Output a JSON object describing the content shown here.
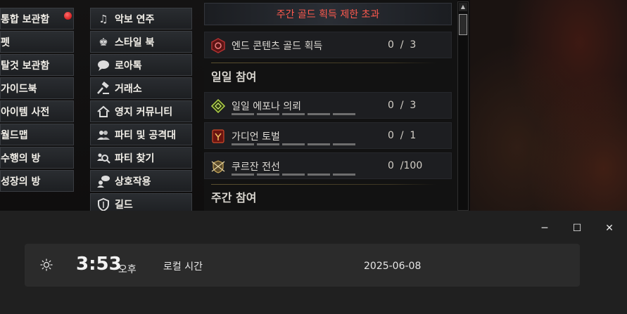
{
  "game": {
    "menu_left": [
      {
        "label": "통합 보관함",
        "has_dot": true
      },
      {
        "label": "펫"
      },
      {
        "label": "탈것 보관함"
      },
      {
        "label": "가이드북"
      },
      {
        "label": "아이템 사전"
      },
      {
        "label": "월드맵"
      },
      {
        "label": "수행의 방"
      },
      {
        "label": "성장의 방"
      }
    ],
    "menu_right": [
      {
        "label": "악보 연주",
        "icon": "music-icon"
      },
      {
        "label": "스타일 북",
        "icon": "style-icon"
      },
      {
        "label": "로아톡",
        "icon": "chat-icon"
      },
      {
        "label": "거래소",
        "icon": "gavel-icon"
      },
      {
        "label": "영지 커뮤니티",
        "icon": "house-icon"
      },
      {
        "label": "파티 및 공격대",
        "icon": "party-icon"
      },
      {
        "label": "파티 찾기",
        "icon": "party-search-icon"
      },
      {
        "label": "상호작용",
        "icon": "interaction-icon"
      },
      {
        "label": "길드",
        "icon": "guild-shield-icon"
      }
    ],
    "panel": {
      "banner": "주간 골드 획득 제한 초과",
      "end_content": {
        "label": "엔드 콘텐츠 골드 획득",
        "count": "0  /  3"
      },
      "daily_title": "일일 참여",
      "daily": [
        {
          "label": "일일 에포나 의뢰",
          "count": "0  /  3",
          "icon": "epona-icon"
        },
        {
          "label": "가디언 토벌",
          "count": "0  /  1",
          "icon": "guardian-icon"
        },
        {
          "label": "쿠르잔 전선",
          "count": "0  /100",
          "icon": "kurzan-icon"
        }
      ],
      "weekly_title": "주간 참여"
    }
  },
  "clock": {
    "time": "3:53",
    "ampm": "오후",
    "timezone": "로컬 시간",
    "date": "2025-06-08",
    "window_buttons": {
      "minimize": "─",
      "maximize": "☐",
      "close": "✕"
    }
  }
}
